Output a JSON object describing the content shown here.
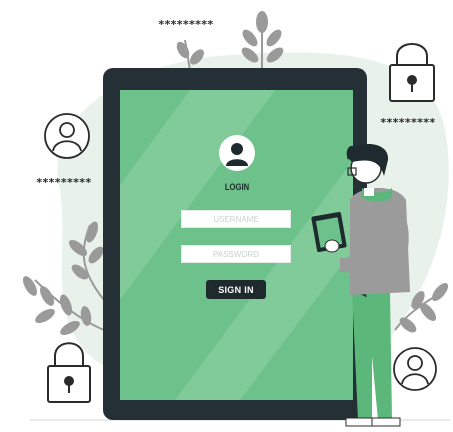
{
  "login_screen": {
    "title": "LOGIN",
    "username_placeholder": "USERNAME",
    "password_placeholder": "PASSWORD",
    "signin_label": "SIGN IN"
  },
  "decorations": {
    "masked_password_top": "*********",
    "masked_password_left": "*********",
    "masked_password_right": "*********"
  },
  "icons": [
    "user-avatar-icon",
    "padlock-icon",
    "leaf-icon"
  ],
  "colors": {
    "screen_green": "#6cc28a",
    "device_frame": "#243036",
    "background_blob": "#e9f1eb",
    "accent_dark": "#1f2a2e",
    "leaf_gray": "#9a9a9a",
    "sweater_gray": "#9b9b9b",
    "pants_green": "#5cb87a"
  }
}
